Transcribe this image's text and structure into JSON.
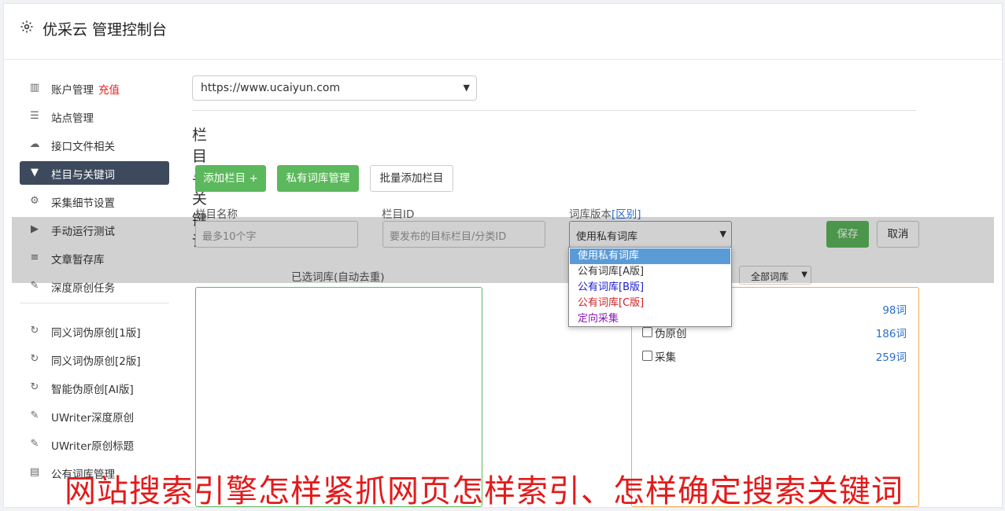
{
  "header": {
    "title": "优采云 管理控制台",
    "icon": "gear-icon"
  },
  "sidebar": {
    "items": [
      {
        "label": "账户管理",
        "badge": "充值",
        "icon": "bar-chart-icon"
      },
      {
        "label": "站点管理",
        "icon": "server-icon"
      },
      {
        "label": "接口文件相关",
        "icon": "cloud-upload-icon"
      },
      {
        "label": "栏目与关键词",
        "icon": "filter-icon",
        "active": true
      },
      {
        "label": "采集细节设置",
        "icon": "cogs-icon"
      },
      {
        "label": "手动运行测试",
        "icon": "play-circle-icon"
      },
      {
        "label": "文章暂存库",
        "icon": "database-icon"
      },
      {
        "label": "深度原创任务",
        "icon": "edit-icon"
      }
    ],
    "items2": [
      {
        "label": "同义词伪原创[1版]",
        "icon": "refresh-icon"
      },
      {
        "label": "同义词伪原创[2版]",
        "icon": "refresh-icon"
      },
      {
        "label": "智能伪原创[AI版]",
        "icon": "refresh-icon"
      },
      {
        "label": "UWriter深度原创",
        "icon": "edit-icon"
      },
      {
        "label": "UWriter原创标题",
        "icon": "edit-icon"
      },
      {
        "label": "公有词库管理",
        "icon": "book-icon"
      }
    ]
  },
  "main": {
    "site_select": "https://www.ucaiyun.com",
    "section_title": "栏目与关键词",
    "buttons": {
      "add_column": "添加栏目 +",
      "private_lib": "私有词库管理",
      "batch_add": "批量添加栏目",
      "save": "保存",
      "cancel": "取消"
    },
    "form": {
      "name_label": "栏目名称",
      "name_placeholder": "最多10个字",
      "id_label": "栏目ID",
      "id_placeholder": "要发布的目标栏目/分类ID",
      "lib_label": "词库版本",
      "lib_link": "[区别]",
      "lib_value": "使用私有词库"
    },
    "selected_note": "已选词库(自动去重)",
    "all_libs_filter": "全部词库",
    "libraries": [
      {
        "name": "",
        "count": "98词"
      },
      {
        "name": "伪原创",
        "count": "186词"
      },
      {
        "name": "采集",
        "count": "259词"
      }
    ],
    "dropdown": [
      {
        "label": "使用私有词库",
        "color": "#ffffff",
        "selected": true
      },
      {
        "label": "公有词库[A版]",
        "color": "#333333"
      },
      {
        "label": "公有词库[B版]",
        "color": "#1a1acc"
      },
      {
        "label": "公有词库[C版]",
        "color": "#d0202a"
      },
      {
        "label": "定向采集",
        "color": "#8a1ab8"
      }
    ]
  },
  "banner": "网站搜索引擎怎样紧抓网页怎样索引、怎样确定搜索关键词",
  "colors": {
    "accent": "#5cb85c",
    "active_nav": "#3d4a5d",
    "banner": "#e21b1b",
    "link": "#2a6fc9"
  }
}
